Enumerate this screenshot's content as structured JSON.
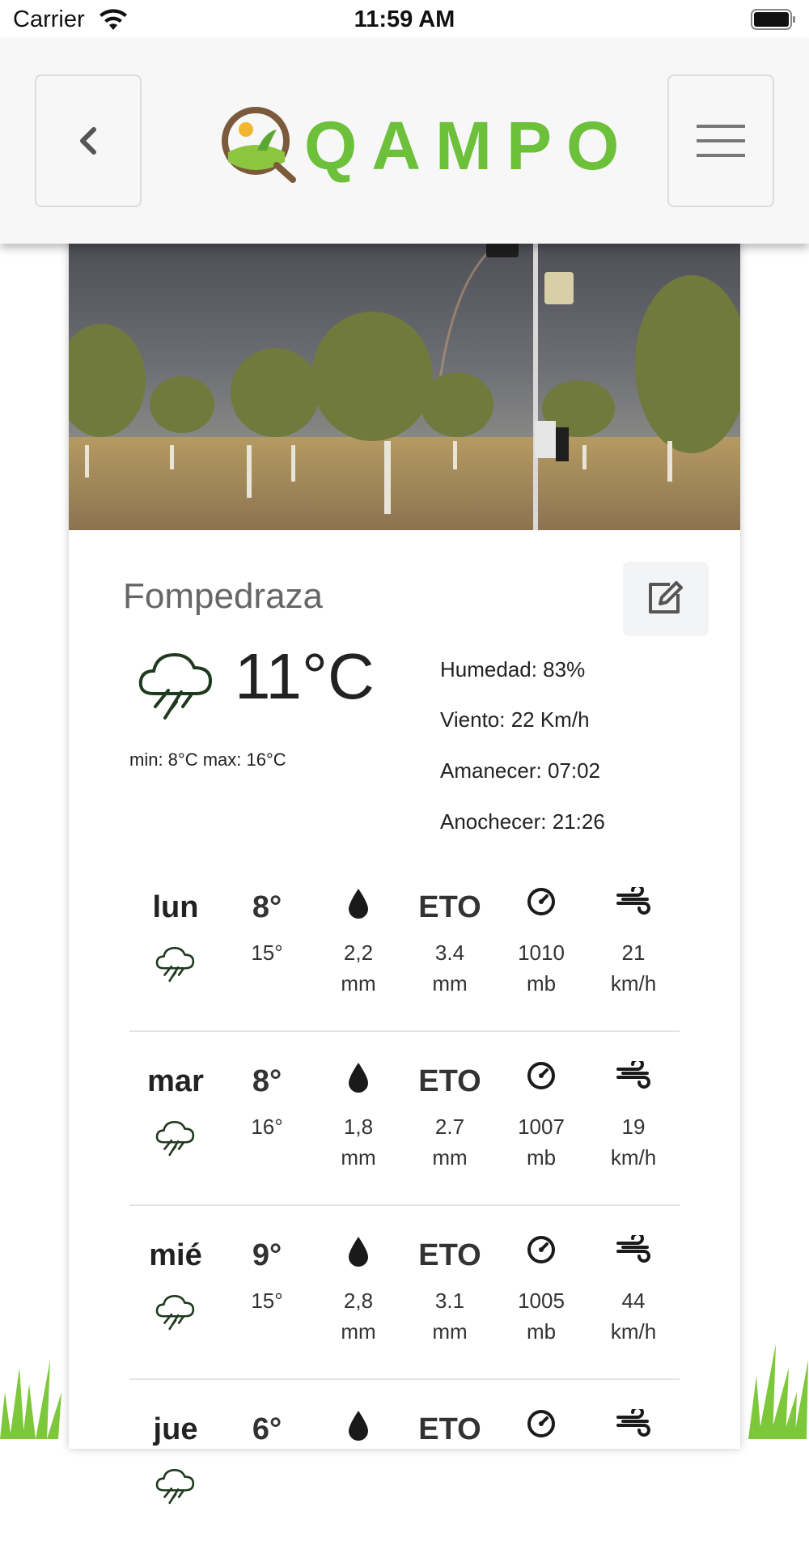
{
  "status_bar": {
    "carrier": "Carrier",
    "time": "11:59 AM"
  },
  "header": {
    "logo_text": "QAMPO",
    "colors": {
      "accent": "#6cc03a"
    }
  },
  "station": {
    "name": "Fompedraza",
    "temperature": "11°C",
    "minmax": "min: 8°C max: 16°C",
    "stats": [
      "Humedad: 83%",
      "Viento: 22 Km/h",
      "Amanecer: 07:02",
      "Anochecer: 21:26"
    ],
    "weather_icon": "rain-cloud-icon"
  },
  "forecast": [
    {
      "day": "lun",
      "low": "8°",
      "high": "15°",
      "rain_value": "2,2",
      "rain_unit": "mm",
      "eto_label": "ETO",
      "eto_value": "3.4",
      "eto_unit": "mm",
      "pressure_value": "1010",
      "pressure_unit": "mb",
      "wind_value": "21",
      "wind_unit": "km/h"
    },
    {
      "day": "mar",
      "low": "8°",
      "high": "16°",
      "rain_value": "1,8",
      "rain_unit": "mm",
      "eto_label": "ETO",
      "eto_value": "2.7",
      "eto_unit": "mm",
      "pressure_value": "1007",
      "pressure_unit": "mb",
      "wind_value": "19",
      "wind_unit": "km/h"
    },
    {
      "day": "mié",
      "low": "9°",
      "high": "15°",
      "rain_value": "2,8",
      "rain_unit": "mm",
      "eto_label": "ETO",
      "eto_value": "3.1",
      "eto_unit": "mm",
      "pressure_value": "1005",
      "pressure_unit": "mb",
      "wind_value": "44",
      "wind_unit": "km/h"
    },
    {
      "day": "jue",
      "low": "6°",
      "high": "",
      "rain_value": "",
      "rain_unit": "",
      "eto_label": "ETO",
      "eto_value": "",
      "eto_unit": "",
      "pressure_value": "",
      "pressure_unit": "",
      "wind_value": "",
      "wind_unit": ""
    }
  ]
}
